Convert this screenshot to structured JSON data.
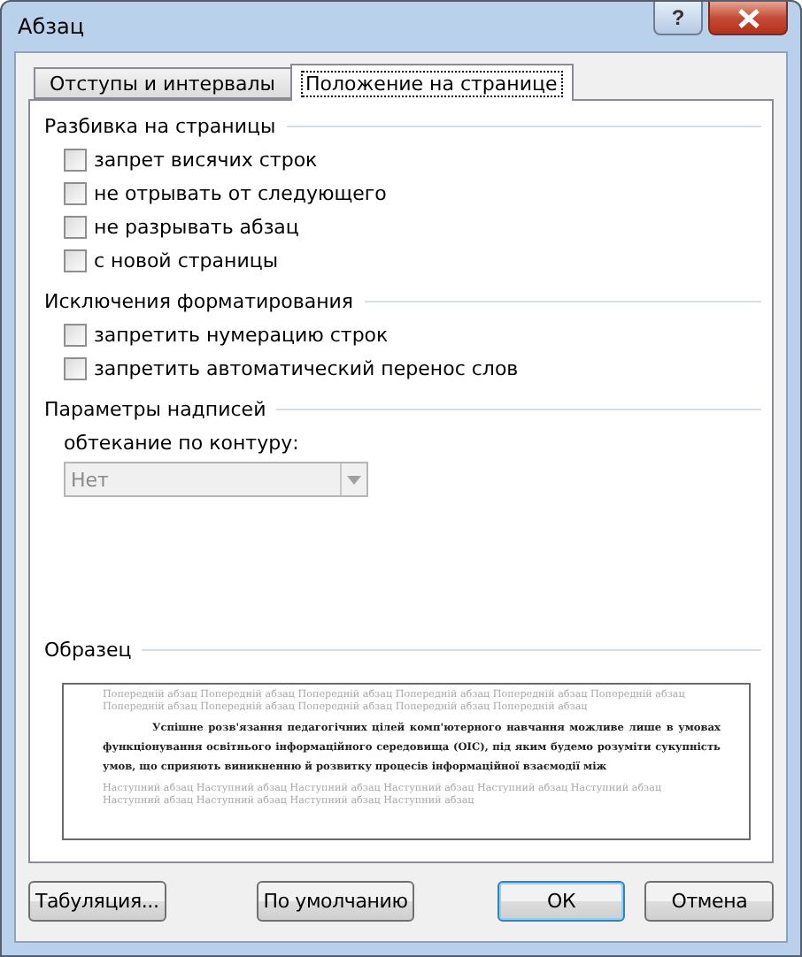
{
  "window": {
    "title": "Абзац",
    "help": "?"
  },
  "tabs": [
    {
      "label": "Отступы и интервалы",
      "selected": false
    },
    {
      "label": "Положение на странице",
      "selected": true
    }
  ],
  "groups": [
    {
      "title": "Разбивка на страницы",
      "options": [
        {
          "label": "запрет висячих строк",
          "checked": false
        },
        {
          "label": "не отрывать от следующего",
          "checked": false
        },
        {
          "label": "не разрывать абзац",
          "checked": false
        },
        {
          "label": "с новой страницы",
          "checked": false
        }
      ]
    },
    {
      "title": "Исключения форматирования",
      "options": [
        {
          "label": "запретить нумерацию строк",
          "checked": false
        },
        {
          "label": "запретить автоматический перенос слов",
          "checked": false
        }
      ]
    }
  ],
  "textbox": {
    "title": "Параметры надписей",
    "label": "обтекание по контуру:",
    "value": "Нет",
    "disabled": true
  },
  "preview": {
    "title": "Образец",
    "before": "Попередній абзац Попередній абзац Попередній абзац Попередній абзац Попередній абзац Попередній абзац Попередній абзац Попередній абзац Попередній абзац Попередній абзац Попередній абзац",
    "current": "Успішне розв'язання педагогічних цілей комп'ютерного навчання можливе лише в умовах функціонування освітнього інформаційного середовища (ОІС), під яким будемо розуміти сукупність умов, що сприяють виникненню й розвитку процесів інформаційної взаємодії між",
    "after": "Наступний абзац Наступний абзац Наступний абзац Наступний абзац Наступний абзац Наступний абзац Наступний абзац Наступний абзац Наступний абзац Наступний абзац"
  },
  "buttons": [
    {
      "label": "Табуляция...",
      "kind": "left"
    },
    {
      "label": "По умолчанию",
      "kind": "left"
    },
    {
      "label": "ОК",
      "kind": "default"
    },
    {
      "label": "Отмена",
      "kind": "normal"
    }
  ]
}
